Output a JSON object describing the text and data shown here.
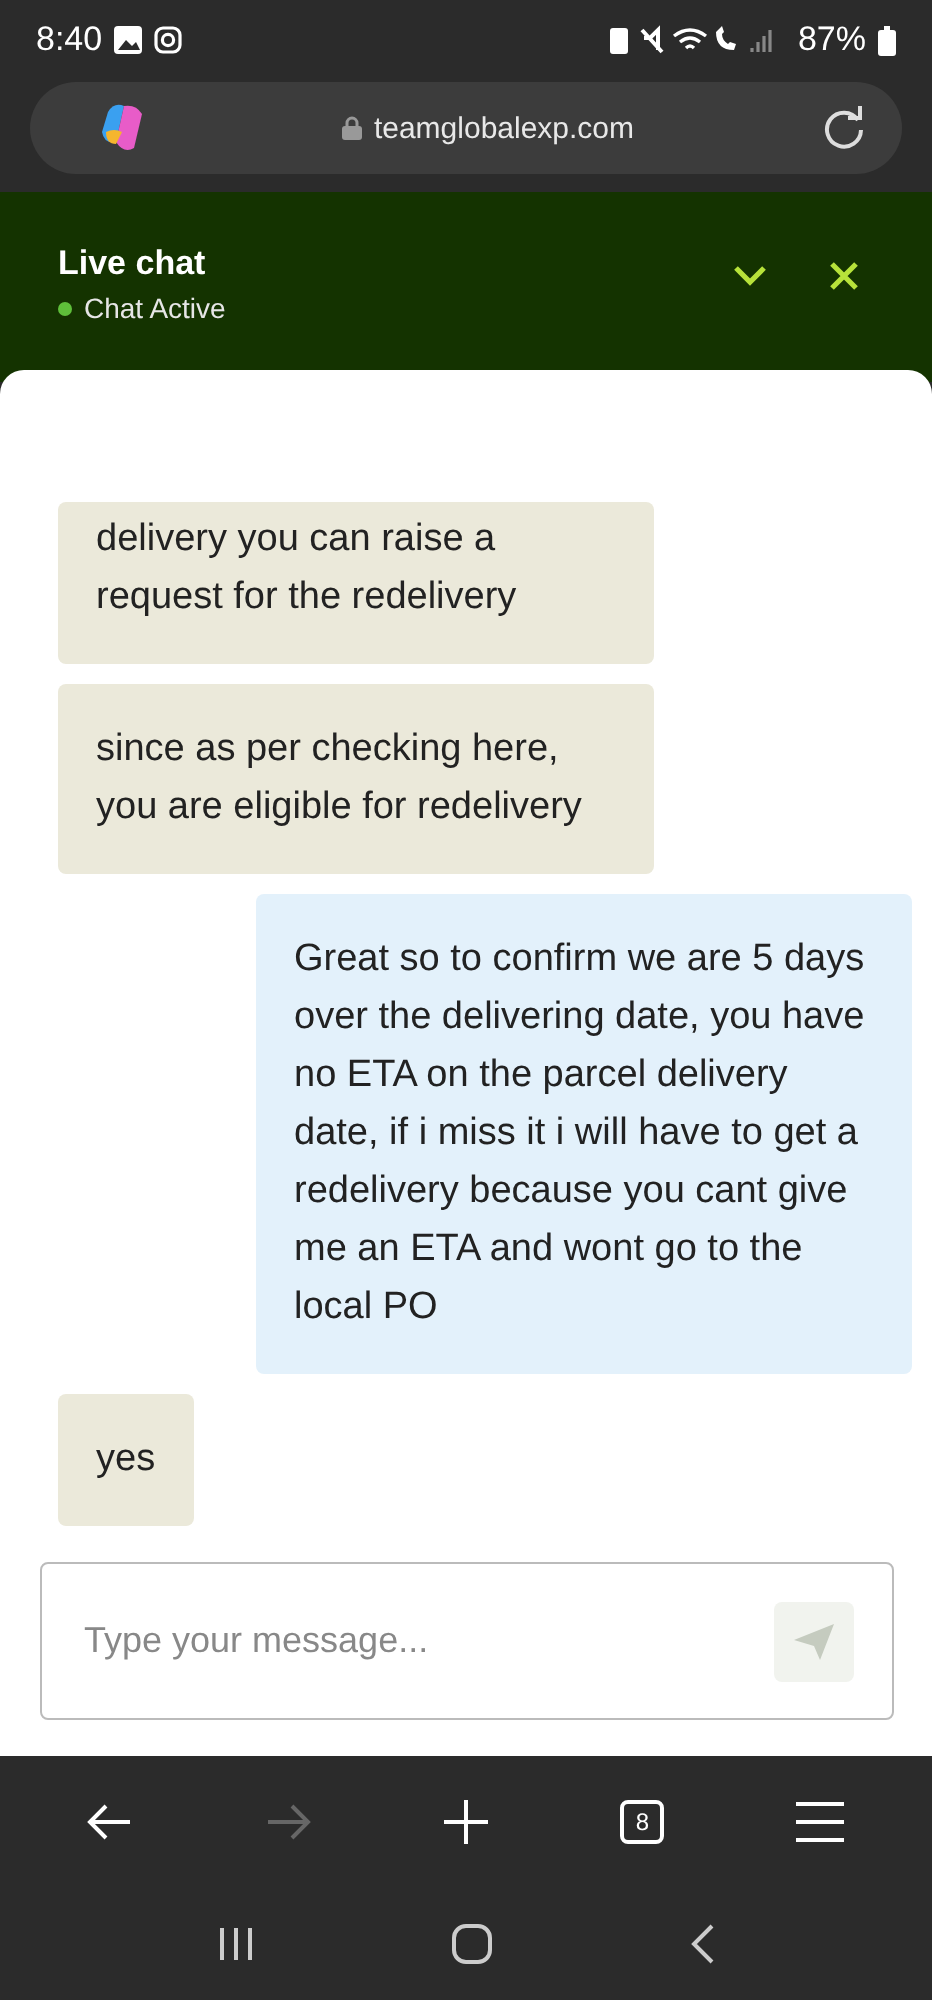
{
  "status_bar": {
    "time": "8:40",
    "battery": "87%"
  },
  "browser_bar": {
    "url": "teamglobalexp.com"
  },
  "chat_header": {
    "title": "Live chat",
    "status": "Chat Active",
    "active": true
  },
  "messages": [
    {
      "kind": "received",
      "text": "delivery you can raise a request for the redelivery"
    },
    {
      "kind": "received",
      "text": "since as per checking here, you are eligible for redelivery"
    },
    {
      "kind": "sent",
      "text": "Great so to confirm we are 5 days over the delivering date, you have no ETA on the parcel delivery date, if i miss it i will have to get a redelivery because you cant give me an ETA and wont go to the local PO"
    },
    {
      "kind": "received",
      "text": "yes"
    }
  ],
  "composer": {
    "placeholder": "Type your message..."
  },
  "browser_nav": [
    {
      "kind": "back",
      "disabled": false
    },
    {
      "kind": "forward",
      "disabled": true
    },
    {
      "kind": "new-tab",
      "disabled": false
    },
    {
      "kind": "tabs",
      "count": "8",
      "disabled": false
    },
    {
      "kind": "menu",
      "disabled": false
    }
  ]
}
